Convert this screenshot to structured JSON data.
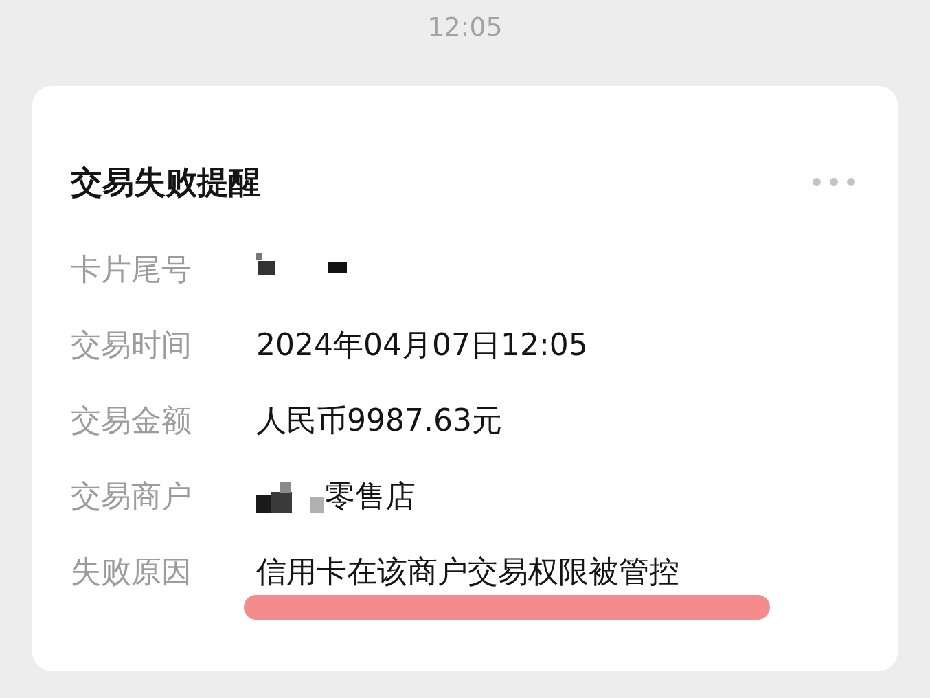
{
  "time": "12:05",
  "card": {
    "title": "交易失败提醒",
    "fields": [
      {
        "label": "卡片尾号",
        "kind": "redacted"
      },
      {
        "label": "交易时间",
        "value": "2024年04月07日12:05",
        "kind": "text"
      },
      {
        "label": "交易金额",
        "value": "人民币9987.63元",
        "kind": "text"
      },
      {
        "label": "交易商户",
        "value": "零售店",
        "kind": "redacted_prefix"
      },
      {
        "label": "失败原因",
        "value": "信用卡在该商户交易权限被管控",
        "kind": "highlighted"
      }
    ]
  }
}
